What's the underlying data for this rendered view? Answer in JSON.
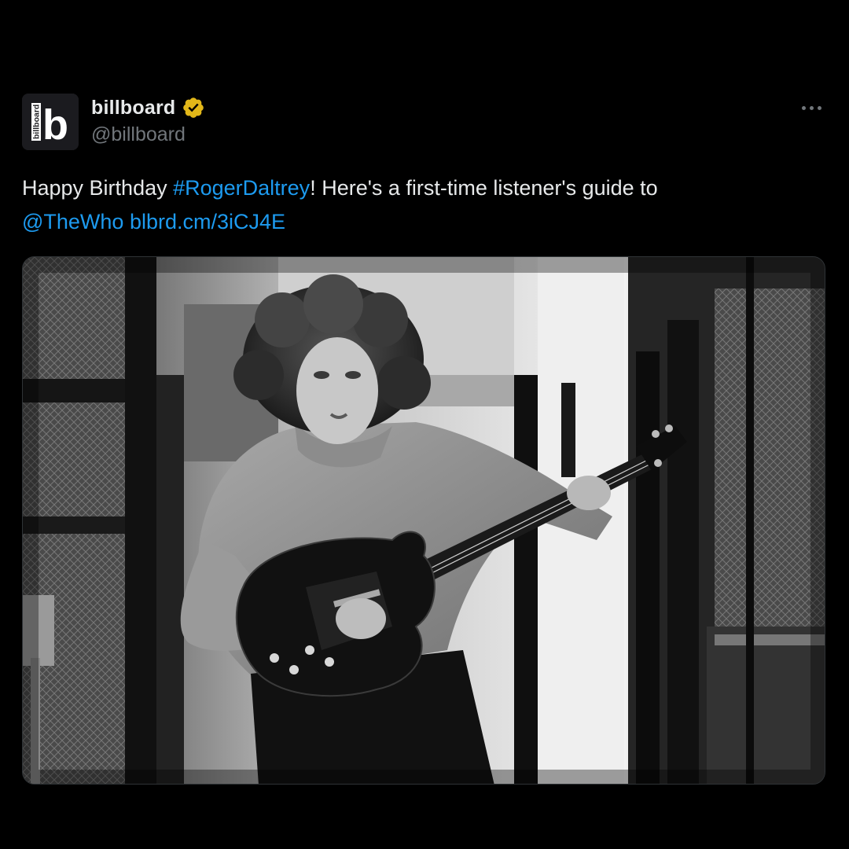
{
  "tweet": {
    "author": {
      "display_name": "billboard",
      "handle": "@billboard",
      "avatar_letter": "b",
      "avatar_wordmark": "billboard",
      "verified_badge_icon": "verified-gold-badge-icon"
    },
    "text": {
      "part1": "Happy Birthday ",
      "hashtag": "#RogerDaltrey",
      "part2": "! Here's a first-time listener's guide to",
      "mention": "@TheWho",
      "url": "blbrd.cm/3iCJ4E"
    },
    "more_icon": "more-horizontal-icon",
    "media": {
      "type": "black-and-white photograph"
    }
  },
  "colors": {
    "background": "#000000",
    "primary_text": "#e7e9ea",
    "secondary_text": "#71767b",
    "link": "#1d9bf0",
    "verified_gold": "#e2b719"
  }
}
